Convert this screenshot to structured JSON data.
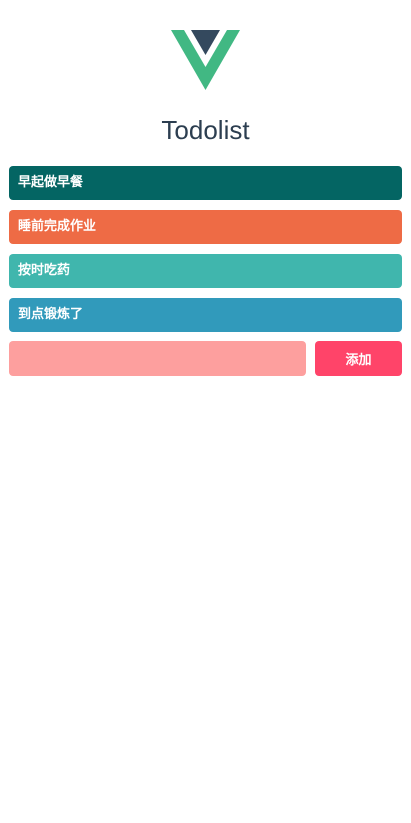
{
  "header": {
    "logo_icon": "vue-logo-icon",
    "title": "Todolist"
  },
  "todos": [
    {
      "text": "早起做早餐",
      "color": "#046563"
    },
    {
      "text": "睡前完成作业",
      "color": "#ee6b45"
    },
    {
      "text": "按时吃药",
      "color": "#40b6ad"
    },
    {
      "text": "到点锻炼了",
      "color": "#319abb"
    }
  ],
  "form": {
    "input_value": "",
    "input_placeholder": "",
    "add_label": "添加",
    "input_color": "#fd9f9e",
    "button_color": "#ff4469"
  },
  "colors": {
    "logo_outer": "#41b883",
    "logo_inner": "#34495e",
    "title_text": "#2c3e50"
  }
}
